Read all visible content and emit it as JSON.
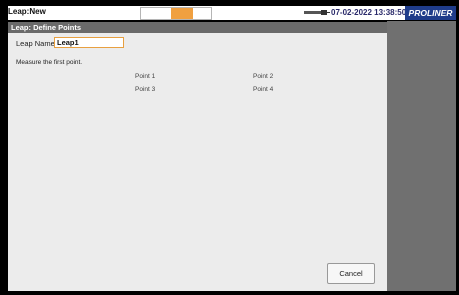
{
  "window": {
    "title": "Leap:New",
    "timestamp": "07-02-2022 13:38:50",
    "logo_text": "PROLINER"
  },
  "dialog": {
    "title": "Leap: Define Points",
    "leap_name_label": "Leap Name",
    "leap_name_value": "Leap1",
    "instruction": "Measure the first point.",
    "points": [
      "Point 1",
      "Point 2",
      "Point 3",
      "Point 4"
    ],
    "cancel_label": "Cancel"
  },
  "colors": {
    "header_bar": "#6a6a6a",
    "logo_bg": "#1f3c8a",
    "accent": "#f0a040",
    "side_panel": "#707070",
    "dialog_bg": "#ececec"
  },
  "icons": {
    "probe": "probe-icon"
  }
}
